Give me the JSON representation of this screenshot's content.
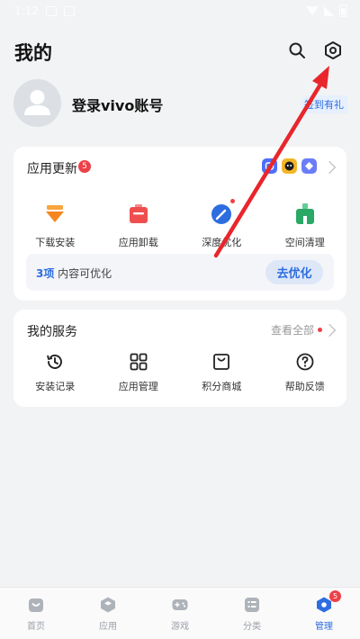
{
  "status_bar": {
    "time": "1:12"
  },
  "header": {
    "title": "我的",
    "search_icon": "search-icon",
    "settings_icon": "settings-hex-icon"
  },
  "profile": {
    "login_text": "登录vivo账号",
    "signin_badge": "签到有礼"
  },
  "updates_card": {
    "title": "应用更新",
    "badge_count": "5",
    "app_thumbs": [
      "#4f6ef7",
      "#f3b626",
      "#6b7cf7"
    ],
    "tools": [
      {
        "label": "下载安装",
        "icon": "download-install-icon",
        "color": "#f5861f"
      },
      {
        "label": "应用卸载",
        "icon": "uninstall-icon",
        "color": "#ef4e4e"
      },
      {
        "label": "深度优化",
        "icon": "deep-optimize-icon",
        "color": "#2d6de0"
      },
      {
        "label": "空间清理",
        "icon": "space-clean-icon",
        "color": "#2aa866"
      }
    ],
    "optimize": {
      "count": "3项",
      "text": " 内容可优化",
      "button": "去优化"
    }
  },
  "services_card": {
    "title": "我的服务",
    "view_all": "查看全部",
    "items": [
      {
        "label": "安装记录",
        "icon": "history-icon"
      },
      {
        "label": "应用管理",
        "icon": "apps-grid-icon"
      },
      {
        "label": "积分商城",
        "icon": "points-mall-icon"
      },
      {
        "label": "帮助反馈",
        "icon": "help-icon"
      }
    ]
  },
  "bottom_nav": {
    "items": [
      {
        "label": "首页",
        "icon": "home-icon"
      },
      {
        "label": "应用",
        "icon": "apps-icon"
      },
      {
        "label": "游戏",
        "icon": "gamepad-icon"
      },
      {
        "label": "分类",
        "icon": "category-icon"
      },
      {
        "label": "管理",
        "icon": "manage-icon",
        "active": true,
        "badge": "5"
      }
    ]
  },
  "colors": {
    "accent": "#2d6de0",
    "badge_red": "#ee4048",
    "arrow_red": "#e8262b",
    "background": "#f2f3f5"
  }
}
